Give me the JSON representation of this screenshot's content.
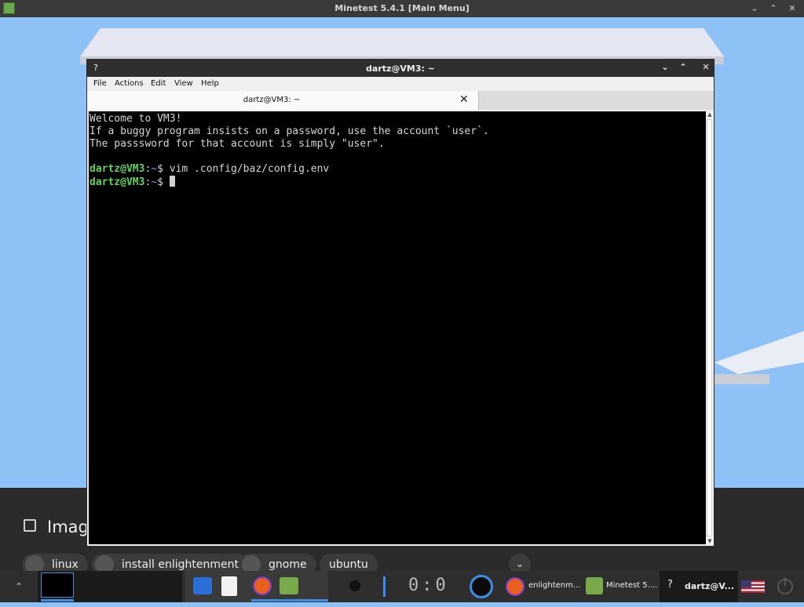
{
  "minetest": {
    "title": "Minetest 5.4.1 [Main Menu]",
    "minimize_glyph": "⌄",
    "maximize_glyph": "⌃",
    "image_label": "Imag",
    "chips": [
      "linux",
      "install enlightenment",
      "gnome",
      "ubuntu"
    ],
    "chevron_glyph": "⌄"
  },
  "terminal": {
    "title": "dartz@VM3: ~",
    "help_glyph": "?",
    "controls": {
      "minimize": "⌄",
      "maximize": "⌃",
      "close": "✕"
    },
    "menu": [
      "File",
      "Actions",
      "Edit",
      "View",
      "Help"
    ],
    "tab_label": "dartz@VM3: ~",
    "tab_close": "✕",
    "lines": [
      "Welcome to VM3!",
      "If a buggy program insists on a password, use the account `user`.",
      "The passsword for that account is simply \"user\"."
    ],
    "prompt_user": "dartz@VM3",
    "prompt_colon": ":",
    "prompt_path": "~",
    "prompt_dollar": "$ ",
    "command": "vim .config/baz/config.env"
  },
  "taskbar": {
    "arrow_glyph": "⌃",
    "clock_text": "0:0",
    "tasks": [
      {
        "label": "enlightenm..."
      },
      {
        "label": "Minetest 5...."
      },
      {
        "label": "dartz@V..."
      }
    ],
    "help_glyph": "?",
    "colors": {
      "accent": "#3b8fe8",
      "active_task": "#1a1a1a"
    }
  }
}
